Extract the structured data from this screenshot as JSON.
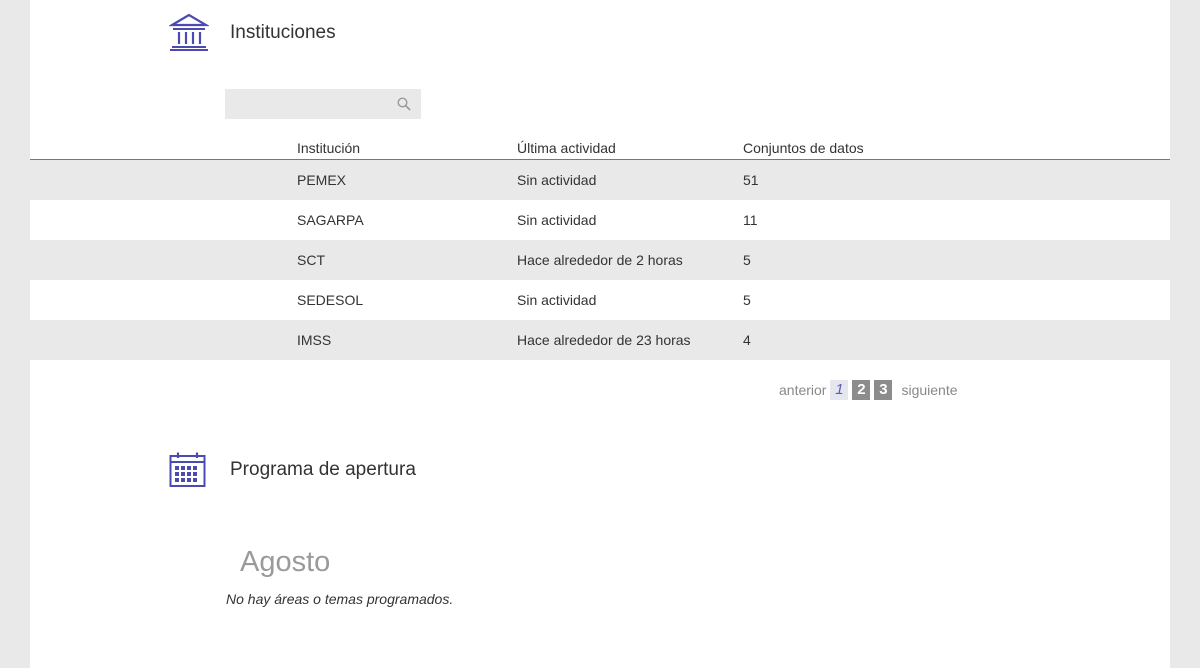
{
  "colors": {
    "accent": "#4a4ab0",
    "row_shade": "#e9e9e9",
    "page_bg": "#e9e9e9"
  },
  "institutions": {
    "title": "Instituciones",
    "icon": "institution-building-icon",
    "search": {
      "placeholder": "",
      "icon": "search-icon"
    },
    "table": {
      "headers": [
        "Institución",
        "Última actividad",
        "Conjuntos de datos"
      ],
      "rows": [
        [
          "PEMEX",
          "Sin actividad",
          "51"
        ],
        [
          "SAGARPA",
          "Sin actividad",
          "11"
        ],
        [
          "SCT",
          "Hace alrededor de 2 horas",
          "5"
        ],
        [
          "SEDESOL",
          "Sin actividad",
          "5"
        ],
        [
          "IMSS",
          "Hace alrededor de 23 horas",
          "4"
        ]
      ]
    },
    "pagination": {
      "prev": "anterior",
      "pages": [
        "1",
        "2",
        "3"
      ],
      "current": "1",
      "next": "siguiente"
    }
  },
  "schedule": {
    "title": "Programa de apertura",
    "icon": "calendar-icon",
    "month": "Agosto",
    "empty_message": "No hay áreas o temas programados."
  }
}
